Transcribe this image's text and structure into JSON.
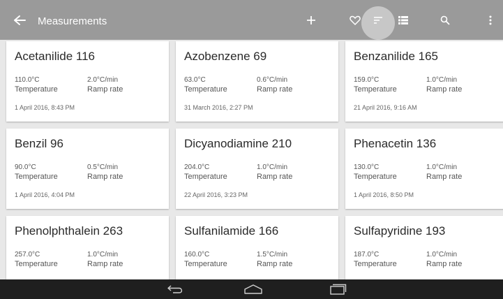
{
  "appbar": {
    "title": "Measurements",
    "actions": [
      "add-icon",
      "favorite-icon",
      "sort-icon",
      "list-view-icon",
      "search-icon",
      "more-vert-icon"
    ]
  },
  "measurements": [
    {
      "name": "Acetanilide 116",
      "temperature": "110.0°C",
      "temperature_label": "Temperature",
      "ramp_rate": "2.0°C/min",
      "ramp_rate_label": "Ramp rate",
      "date": "1 April 2016, 8:43 PM"
    },
    {
      "name": "Azobenzene 69",
      "temperature": "63.0°C",
      "temperature_label": "Temperature",
      "ramp_rate": "0.6°C/min",
      "ramp_rate_label": "Ramp rate",
      "date": "31 March 2016, 2:27 PM"
    },
    {
      "name": "Benzanilide 165",
      "temperature": "159.0°C",
      "temperature_label": "Temperature",
      "ramp_rate": "1.0°C/min",
      "ramp_rate_label": "Ramp rate",
      "date": "21 April 2016, 9:16 AM"
    },
    {
      "name": "Benzil 96",
      "temperature": "90.0°C",
      "temperature_label": "Temperature",
      "ramp_rate": "0.5°C/min",
      "ramp_rate_label": "Ramp rate",
      "date": "1 April 2016, 4:04 PM"
    },
    {
      "name": "Dicyanodiamine 210",
      "temperature": "204.0°C",
      "temperature_label": "Temperature",
      "ramp_rate": "1.0°C/min",
      "ramp_rate_label": "Ramp rate",
      "date": "22 April 2016, 3:23 PM"
    },
    {
      "name": "Phenacetin 136",
      "temperature": "130.0°C",
      "temperature_label": "Temperature",
      "ramp_rate": "1.0°C/min",
      "ramp_rate_label": "Ramp rate",
      "date": "1 April 2016, 8:50 PM"
    },
    {
      "name": "Phenolphthalein 263",
      "temperature": "257.0°C",
      "temperature_label": "Temperature",
      "ramp_rate": "1.0°C/min",
      "ramp_rate_label": "Ramp rate",
      "date": ""
    },
    {
      "name": "Sulfanilamide 166",
      "temperature": "160.0°C",
      "temperature_label": "Temperature",
      "ramp_rate": "1.5°C/min",
      "ramp_rate_label": "Ramp rate",
      "date": ""
    },
    {
      "name": "Sulfapyridine 193",
      "temperature": "187.0°C",
      "temperature_label": "Temperature",
      "ramp_rate": "1.0°C/min",
      "ramp_rate_label": "Ramp rate",
      "date": ""
    }
  ],
  "navbar": {
    "buttons": [
      "back-icon",
      "home-icon",
      "recents-icon"
    ]
  },
  "colors": {
    "appbar": "#9a9a9a",
    "background": "#e8e8e8",
    "card": "#ffffff",
    "navbar": "#1f1f1f"
  }
}
